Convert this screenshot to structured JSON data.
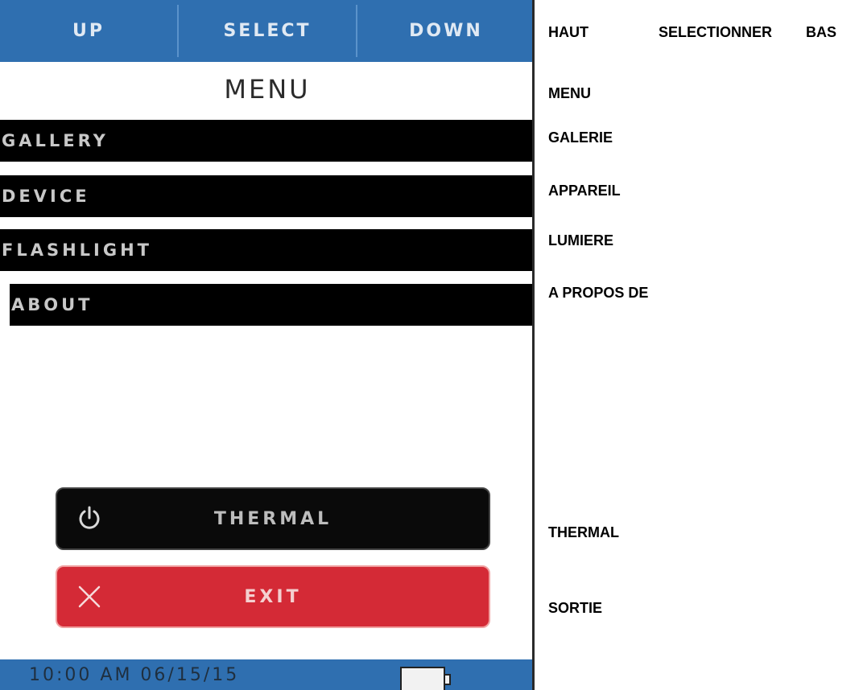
{
  "device": {
    "topbar": {
      "up": "UP",
      "select": "SELECT",
      "down": "DOWN"
    },
    "title": "MENU",
    "menu": {
      "gallery": "GALLERY",
      "device": "DEVICE",
      "flashlight": "FLASHLIGHT",
      "about": "ABOUT"
    },
    "thermal": {
      "label": "THERMAL",
      "icon": "power-icon"
    },
    "exit": {
      "label": "EXIT",
      "icon": "close-icon"
    },
    "status": {
      "time": "10:00 AM 06/15/15",
      "battery_icon": "battery-icon"
    },
    "colors": {
      "bar_blue": "#2f6fb0",
      "exit_red": "#d42a36",
      "row_black": "#000000"
    }
  },
  "translations": {
    "up": "HAUT",
    "select": "SELECTIONNER",
    "down": "BAS",
    "menu": "MENU",
    "gallery": "GALERIE",
    "device": "APPAREIL",
    "flashlight": "LUMIERE",
    "about": "A PROPOS DE",
    "thermal": "THERMAL",
    "exit": "SORTIE"
  }
}
